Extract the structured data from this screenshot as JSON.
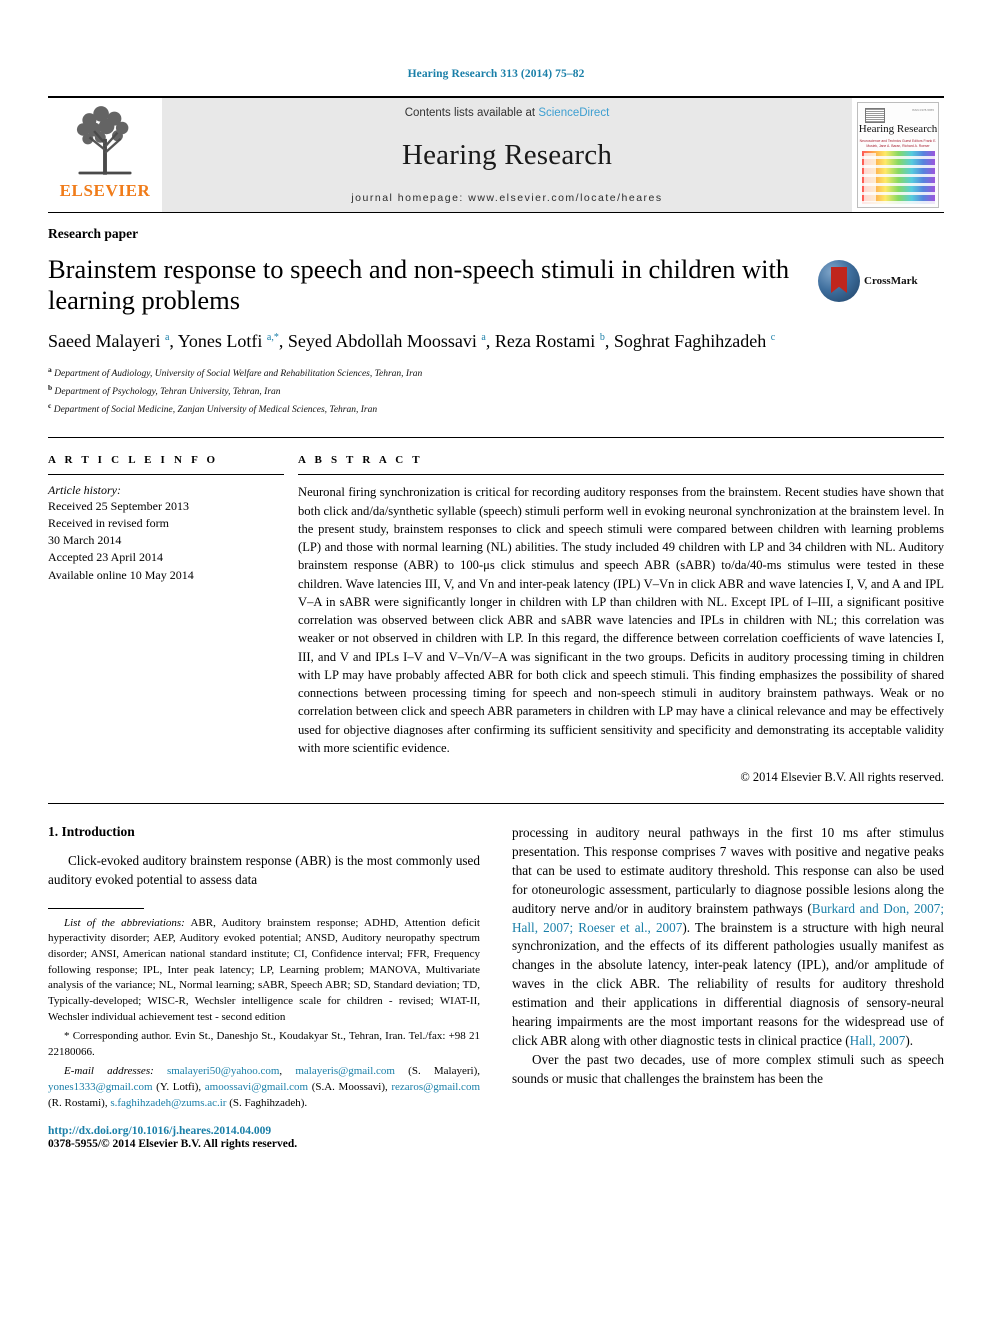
{
  "running_head": "Hearing Research 313 (2014) 75–82",
  "masthead": {
    "elsevier_word": "ELSEVIER",
    "contents_prefix": "Contents lists available at ",
    "sciencedirect": "ScienceDirect",
    "journal_title": "Hearing Research",
    "homepage": "journal homepage: www.elsevier.com/locate/heares",
    "cover": {
      "title": "Hearing Research",
      "subtitle": "Neuroscience and Technics\nGuest Editors\nFrank E. Musiek, Jane A. Baran, Richard A. Roeser"
    }
  },
  "article": {
    "type": "Research paper",
    "title": "Brainstem response to speech and non-speech stimuli in children with learning problems",
    "crossmark_label": "CrossMark",
    "authors_html": "Saeed Malayeri <sup>a</sup>, Yones Lotfi <sup>a,*</sup>, Seyed Abdollah Moossavi <sup>a</sup>, Reza Rostami <sup>b</sup>, Soghrat Faghihzadeh <sup>c</sup>",
    "affiliations": [
      {
        "marker": "a",
        "text": "Department of Audiology, University of Social Welfare and Rehabilitation Sciences, Tehran, Iran"
      },
      {
        "marker": "b",
        "text": "Department of Psychology, Tehran University, Tehran, Iran"
      },
      {
        "marker": "c",
        "text": "Department of Social Medicine, Zanjan University of Medical Sciences, Tehran, Iran"
      }
    ]
  },
  "article_info": {
    "heading": "A R T I C L E   I N F O",
    "history_label": "Article history:",
    "history": [
      "Received 25 September 2013",
      "Received in revised form",
      "30 March 2014",
      "Accepted 23 April 2014",
      "Available online 10 May 2014"
    ]
  },
  "abstract": {
    "heading": "A B S T R A C T",
    "text": "Neuronal firing synchronization is critical for recording auditory responses from the brainstem. Recent studies have shown that both click and/da/synthetic syllable (speech) stimuli perform well in evoking neuronal synchronization at the brainstem level. In the present study, brainstem responses to click and speech stimuli were compared between children with learning problems (LP) and those with normal learning (NL) abilities. The study included 49 children with LP and 34 children with NL. Auditory brainstem response (ABR) to 100-μs click stimulus and speech ABR (sABR) to/da/40-ms stimulus were tested in these children. Wave latencies III, V, and Vn and inter-peak latency (IPL) V–Vn in click ABR and wave latencies I, V, and A and IPL V–A in sABR were significantly longer in children with LP than children with NL. Except IPL of I–III, a significant positive correlation was observed between click ABR and sABR wave latencies and IPLs in children with NL; this correlation was weaker or not observed in children with LP. In this regard, the difference between correlation coefficients of wave latencies I, III, and V and IPLs I–V and V–Vn/V–A was significant in the two groups. Deficits in auditory processing timing in children with LP may have probably affected ABR for both click and speech stimuli. This finding emphasizes the possibility of shared connections between processing timing for speech and non-speech stimuli in auditory brainstem pathways. Weak or no correlation between click and speech ABR parameters in children with LP may have a clinical relevance and may be effectively used for objective diagnoses after confirming its sufficient sensitivity and specificity and demonstrating its acceptable validity with more scientific evidence.",
    "copyright": "© 2014 Elsevier B.V. All rights reserved."
  },
  "introduction": {
    "heading": "1.  Introduction",
    "left_para": "Click-evoked auditory brainstem response (ABR) is the most commonly used auditory evoked potential to assess data",
    "right_para_1_a": "processing in auditory neural pathways in the first 10 ms after stimulus presentation. This response comprises 7 waves with positive and negative peaks that can be used to estimate auditory threshold. This response can also be used for otoneurologic assessment, particularly to diagnose possible lesions along the auditory nerve and/or in auditory brainstem pathways (",
    "right_ref_1": "Burkard and Don, 2007; Hall, 2007; Roeser et al., 2007",
    "right_para_1_b": "). The brainstem is a structure with high neural synchronization, and the effects of its different pathologies usually manifest as changes in the absolute latency, inter-peak latency (IPL), and/or amplitude of waves in the click ABR. The reliability of results for auditory threshold estimation and their applications in differential diagnosis of sensory-neural hearing impairments are the most important reasons for the widespread use of click ABR along with other diagnostic tests in clinical practice (",
    "right_ref_2": "Hall, 2007",
    "right_para_1_c": ").",
    "right_para_2": "Over the past two decades, use of more complex stimuli such as speech sounds or music that challenges the brainstem has been the"
  },
  "footnotes": {
    "abbrev_label": "List of the abbreviations:",
    "abbrev_text": " ABR, Auditory brainstem response; ADHD, Attention deficit hyperactivity disorder; AEP, Auditory evoked potential; ANSD, Auditory neuropathy spectrum disorder; ANSI, American national standard institute; CI, Confidence interval; FFR, Frequency following response; IPL, Inter peak latency; LP, Learning problem; MANOVA, Multivariate analysis of the variance; NL, Normal learning; sABR, Speech ABR; SD, Standard deviation; TD, Typically-developed; WISC-R, Wechsler intelligence scale for children - revised; WIAT-II, Wechsler individual achievement test - second edition",
    "corresponding": "* Corresponding author. Evin St., Daneshjo St., Koudakyar St., Tehran, Iran. Tel./fax: +98 21 22180066.",
    "email_label": "E-mail addresses:",
    "emails": [
      {
        "address": "smalayeri50@yahoo.com",
        "sep": ", "
      },
      {
        "address": "malayeris@gmail.com",
        "sep": " (S. Malayeri), "
      },
      {
        "address": "yones1333@gmail.com",
        "sep": " (Y. Lotfi), "
      },
      {
        "address": "amoossavi@gmail.com",
        "sep": " (S.A. Moossavi), "
      },
      {
        "address": "rezaros@gmail.com",
        "sep": " (R. Rostami), "
      },
      {
        "address": "s.faghihzadeh@zums.ac.ir",
        "sep": " (S. Faghihzadeh)."
      }
    ]
  },
  "bottom": {
    "doi": "http://dx.doi.org/10.1016/j.heares.2014.04.009",
    "issn": "0378-5955/© 2014 Elsevier B.V. All rights reserved."
  }
}
